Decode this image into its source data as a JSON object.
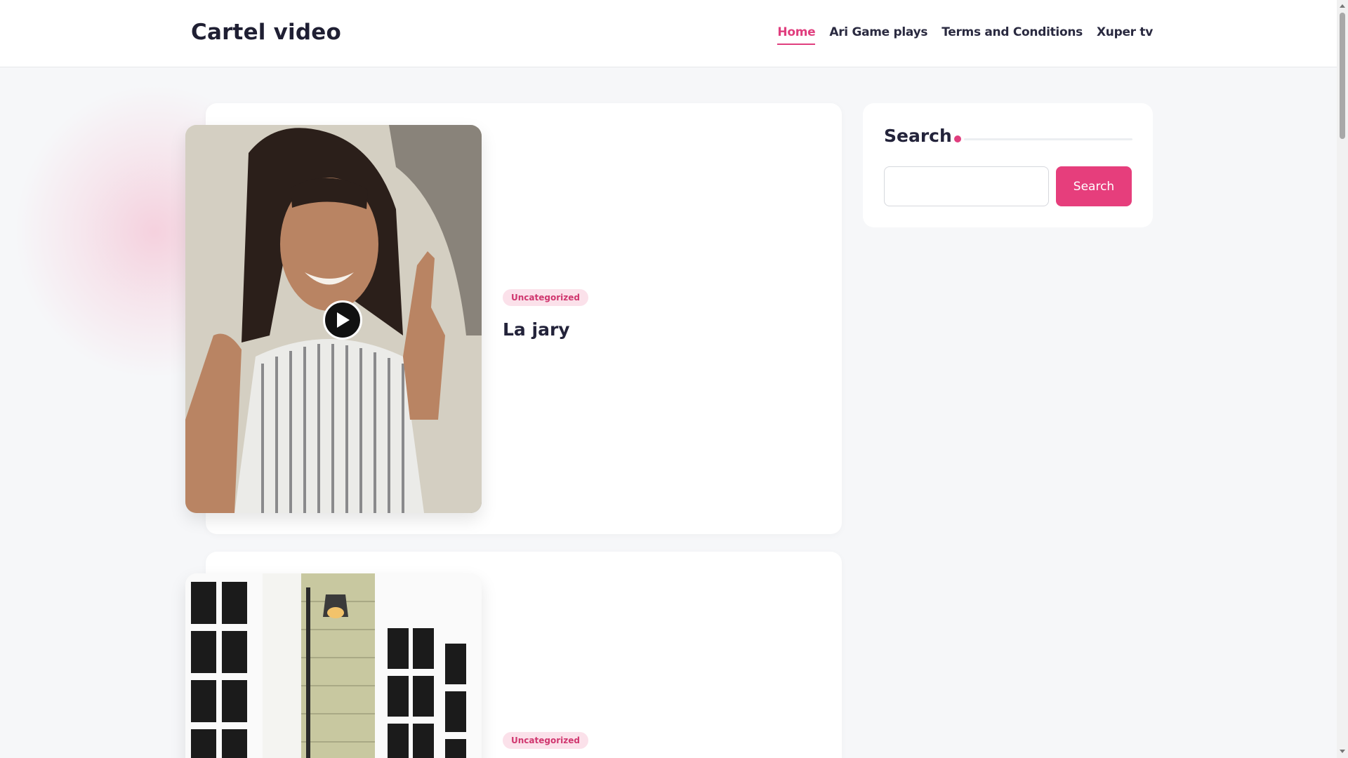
{
  "header": {
    "site_title": "Cartel video",
    "nav": [
      {
        "label": "Home",
        "active": true
      },
      {
        "label": "Ari Game plays",
        "active": false
      },
      {
        "label": "Terms and Conditions",
        "active": false
      },
      {
        "label": "Xuper tv",
        "active": false
      }
    ]
  },
  "posts": [
    {
      "category": "Uncategorized",
      "title": "La jary",
      "has_play_button": true
    },
    {
      "category": "Uncategorized",
      "title": ""
    }
  ],
  "sidebar": {
    "search_widget": {
      "title": "Search",
      "input_value": "",
      "button_label": "Search"
    }
  },
  "colors": {
    "accent": "#e03e7e",
    "badge_bg": "#fbe1ea",
    "button_bg": "#e63e7c",
    "page_bg": "#f6f7f9"
  },
  "icons": [
    "play-icon"
  ]
}
